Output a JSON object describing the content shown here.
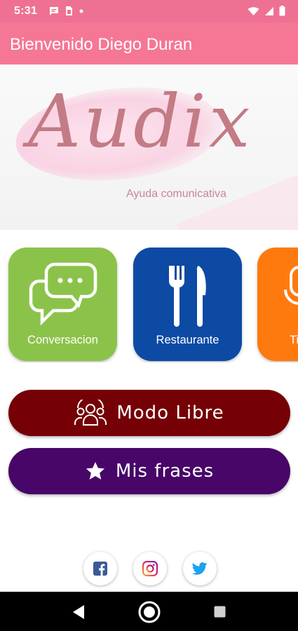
{
  "status_bar": {
    "time": "5:31",
    "left_icons": [
      "message-icon",
      "sim-icon",
      "dot-icon"
    ],
    "right_icons": [
      "wifi-icon",
      "signal-icon",
      "battery-icon"
    ]
  },
  "app_bar": {
    "title": "Bienvenido Diego Duran",
    "color": "#f57795"
  },
  "banner": {
    "logo_text": "Audix",
    "subtitle": "Ayuda comunicativa"
  },
  "categories": [
    {
      "label": "Conversacion",
      "icon": "chat-bubbles-icon",
      "color": "#8bc34a"
    },
    {
      "label": "Restaurante",
      "icon": "fork-knife-icon",
      "color": "#0d4aa4"
    },
    {
      "label": "Ti",
      "icon": "microphone-icon",
      "color": "#ff7a0e"
    }
  ],
  "buttons": {
    "modo_libre": {
      "label": "Modo Libre",
      "icon": "group-icon",
      "color": "#750106"
    },
    "mis_frases": {
      "label": "Mis frases",
      "icon": "star-icon",
      "color": "#470668"
    }
  },
  "social": [
    {
      "icon": "facebook-icon"
    },
    {
      "icon": "instagram-icon"
    },
    {
      "icon": "twitter-icon"
    }
  ],
  "nav_bar": {
    "icons": [
      "back-icon",
      "home-icon",
      "recents-icon"
    ]
  }
}
